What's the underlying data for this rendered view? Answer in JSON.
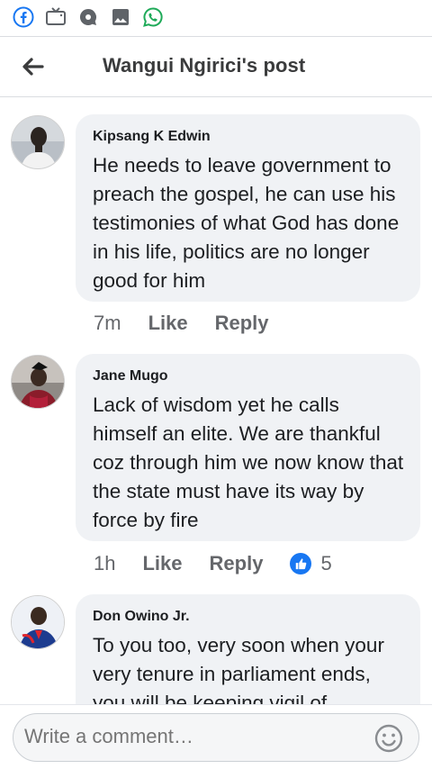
{
  "header": {
    "title": "Wangui Ngirici's post"
  },
  "status_bar": {
    "icons": [
      "facebook-icon",
      "tv-icon",
      "settings-bubble-icon",
      "image-icon",
      "whatsapp-icon"
    ]
  },
  "comments": [
    {
      "author": "Kipsang K Edwin",
      "text": "He needs to leave government to preach the gospel, he can use his testimonies of what God has done in his life, politics are no longer good for him",
      "time": "7m",
      "like_label": "Like",
      "reply_label": "Reply"
    },
    {
      "author": "Jane Mugo",
      "text": "Lack of wisdom yet he calls himself an elite. We are thankful coz through him we now know that the state must have its way by force by fire",
      "time": "1h",
      "like_label": "Like",
      "reply_label": "Reply",
      "reaction_count": "5"
    },
    {
      "author": "Don Owino Jr.",
      "text": "To you too, very soon when your very tenure in parliament ends, you will be keeping vigil of"
    }
  ],
  "composer": {
    "placeholder": "Write a comment…"
  },
  "colors": {
    "accent": "#1877f2",
    "bubble": "#f0f2f5",
    "meta_text": "#65676b"
  }
}
